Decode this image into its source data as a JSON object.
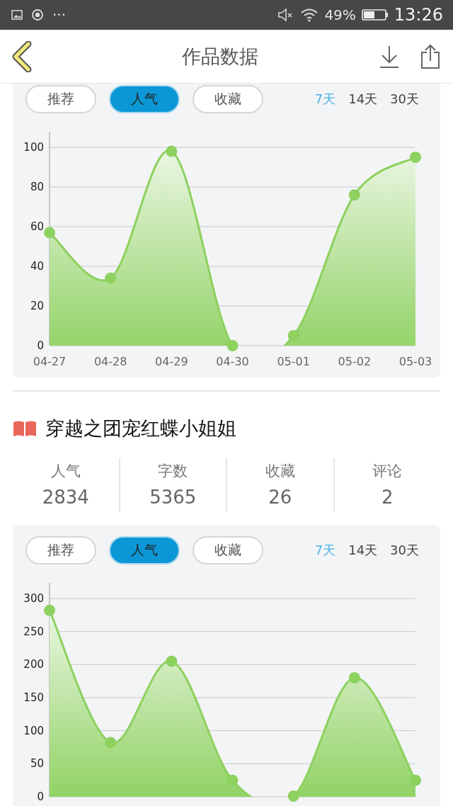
{
  "status_bar": {
    "more": "···",
    "battery": "49%",
    "time": "13:26"
  },
  "header": {
    "title": "作品数据"
  },
  "panels": [
    {
      "metric_tabs": [
        {
          "label": "推荐",
          "selected": false
        },
        {
          "label": "人气",
          "selected": true
        },
        {
          "label": "收藏",
          "selected": false
        }
      ],
      "ranges": [
        {
          "label": "7天",
          "selected": true
        },
        {
          "label": "14天",
          "selected": false
        },
        {
          "label": "30天",
          "selected": false
        }
      ],
      "chart_data": {
        "type": "area",
        "grid": true,
        "categories": [
          "04-27",
          "04-28",
          "04-29",
          "04-30",
          "05-01",
          "05-02",
          "05-03"
        ],
        "ylim": [
          0,
          100
        ],
        "yticks": [
          0,
          20,
          40,
          60,
          80,
          100
        ],
        "series": [
          {
            "color": "#8dd15f",
            "values": [
              57,
              34,
              98,
              0,
              5,
              76,
              95
            ]
          }
        ]
      }
    }
  ],
  "book": {
    "title": "穿越之团宠红蝶小姐姐",
    "stats": [
      {
        "label": "人气",
        "value": "2834"
      },
      {
        "label": "字数",
        "value": "5365"
      },
      {
        "label": "收藏",
        "value": "26"
      },
      {
        "label": "评论",
        "value": "2"
      }
    ]
  },
  "panels_2": [
    {
      "metric_tabs": [
        {
          "label": "推荐",
          "selected": false
        },
        {
          "label": "人气",
          "selected": true
        },
        {
          "label": "收藏",
          "selected": false
        }
      ],
      "ranges": [
        {
          "label": "7天",
          "selected": true
        },
        {
          "label": "14天",
          "selected": false
        },
        {
          "label": "30天",
          "selected": false
        }
      ],
      "chart_data": {
        "type": "area",
        "grid": true,
        "ylim": [
          0,
          300
        ],
        "yticks": [
          0,
          50,
          100,
          150,
          200,
          250,
          300
        ],
        "series": [
          {
            "color": "#8dd15f",
            "values": [
              282,
              82,
              205,
              25,
              1,
              180,
              25
            ]
          }
        ]
      }
    }
  ]
}
